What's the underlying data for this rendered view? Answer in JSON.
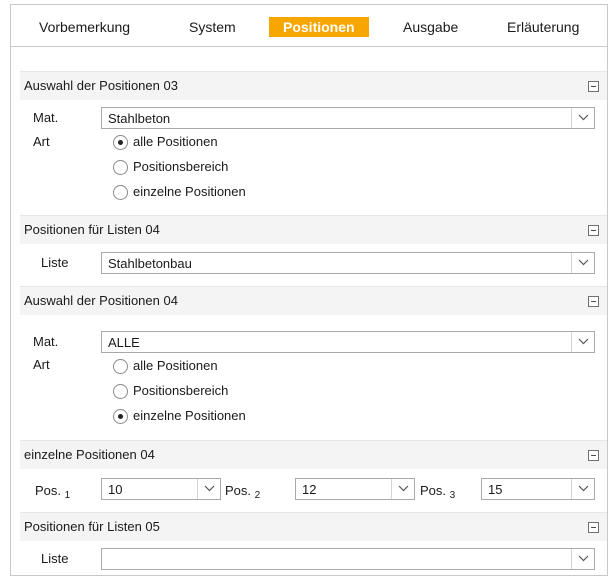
{
  "tabs": [
    {
      "label": "Vorbemerkung",
      "active": false
    },
    {
      "label": "System",
      "active": false
    },
    {
      "label": "Positionen",
      "active": true
    },
    {
      "label": "Ausgabe",
      "active": false
    },
    {
      "label": "Erläuterung",
      "active": false
    }
  ],
  "sections": {
    "auswahl03": {
      "title": "Auswahl der Positionen 03",
      "mat_label": "Mat.",
      "mat_value": "Stahlbeton",
      "art_label": "Art",
      "options": [
        "alle Positionen",
        "Positionsbereich",
        "einzelne Positionen"
      ],
      "selected": 0
    },
    "listen04": {
      "title": "Positionen für Listen 04",
      "liste_label": "Liste",
      "liste_value": "Stahlbetonbau"
    },
    "auswahl04": {
      "title": "Auswahl der Positionen 04",
      "mat_label": "Mat.",
      "mat_value": "ALLE",
      "art_label": "Art",
      "options": [
        "alle Positionen",
        "Positionsbereich",
        "einzelne Positionen"
      ],
      "selected": 2
    },
    "einzelne04": {
      "title": "einzelne Positionen 04",
      "pos_label": "Pos.",
      "pos": [
        {
          "index": "1",
          "value": "10"
        },
        {
          "index": "2",
          "value": "12"
        },
        {
          "index": "3",
          "value": "15"
        }
      ]
    },
    "listen05": {
      "title": "Positionen für Listen 05",
      "liste_label": "Liste",
      "liste_value": ""
    }
  },
  "colors": {
    "accent": "#f7a600",
    "section_bg": "#f4f4f4",
    "border": "#a9a9a9"
  },
  "icons": {
    "dropdown": "chevron-down-icon",
    "collapse": "collapse-minus-icon"
  }
}
